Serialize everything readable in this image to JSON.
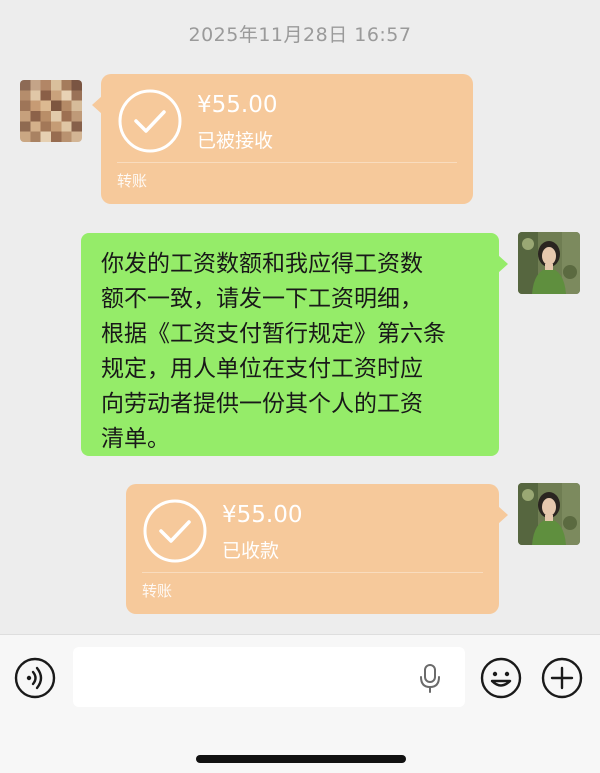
{
  "chat": {
    "timestamp": "2025年11月28日 16:57",
    "messages": [
      {
        "type": "transfer",
        "side": "left",
        "amount": "¥55.00",
        "status": "已被接收",
        "kind": "转账"
      },
      {
        "type": "text",
        "side": "right",
        "lines": [
          "你发的工资数额和我应得工资数",
          "额不一致，请发一下工资明细，",
          "根据《工资支付暂行规定》第六条",
          "规定，用人单位在支付工资时应",
          "向劳动者提供一份其个人的工资",
          "清单。"
        ]
      },
      {
        "type": "transfer",
        "side": "right",
        "amount": "¥55.00",
        "status": "已收款",
        "kind": "转账"
      }
    ]
  },
  "toolbar": {
    "voice_icon": "voice-icon",
    "mic_icon": "mic-icon",
    "emoji_icon": "emoji-icon",
    "plus_icon": "plus-icon",
    "input_value": ""
  },
  "colors": {
    "background": "#ededed",
    "transfer_bubble": "#f6c99b",
    "text_bubble": "#95ec69"
  }
}
